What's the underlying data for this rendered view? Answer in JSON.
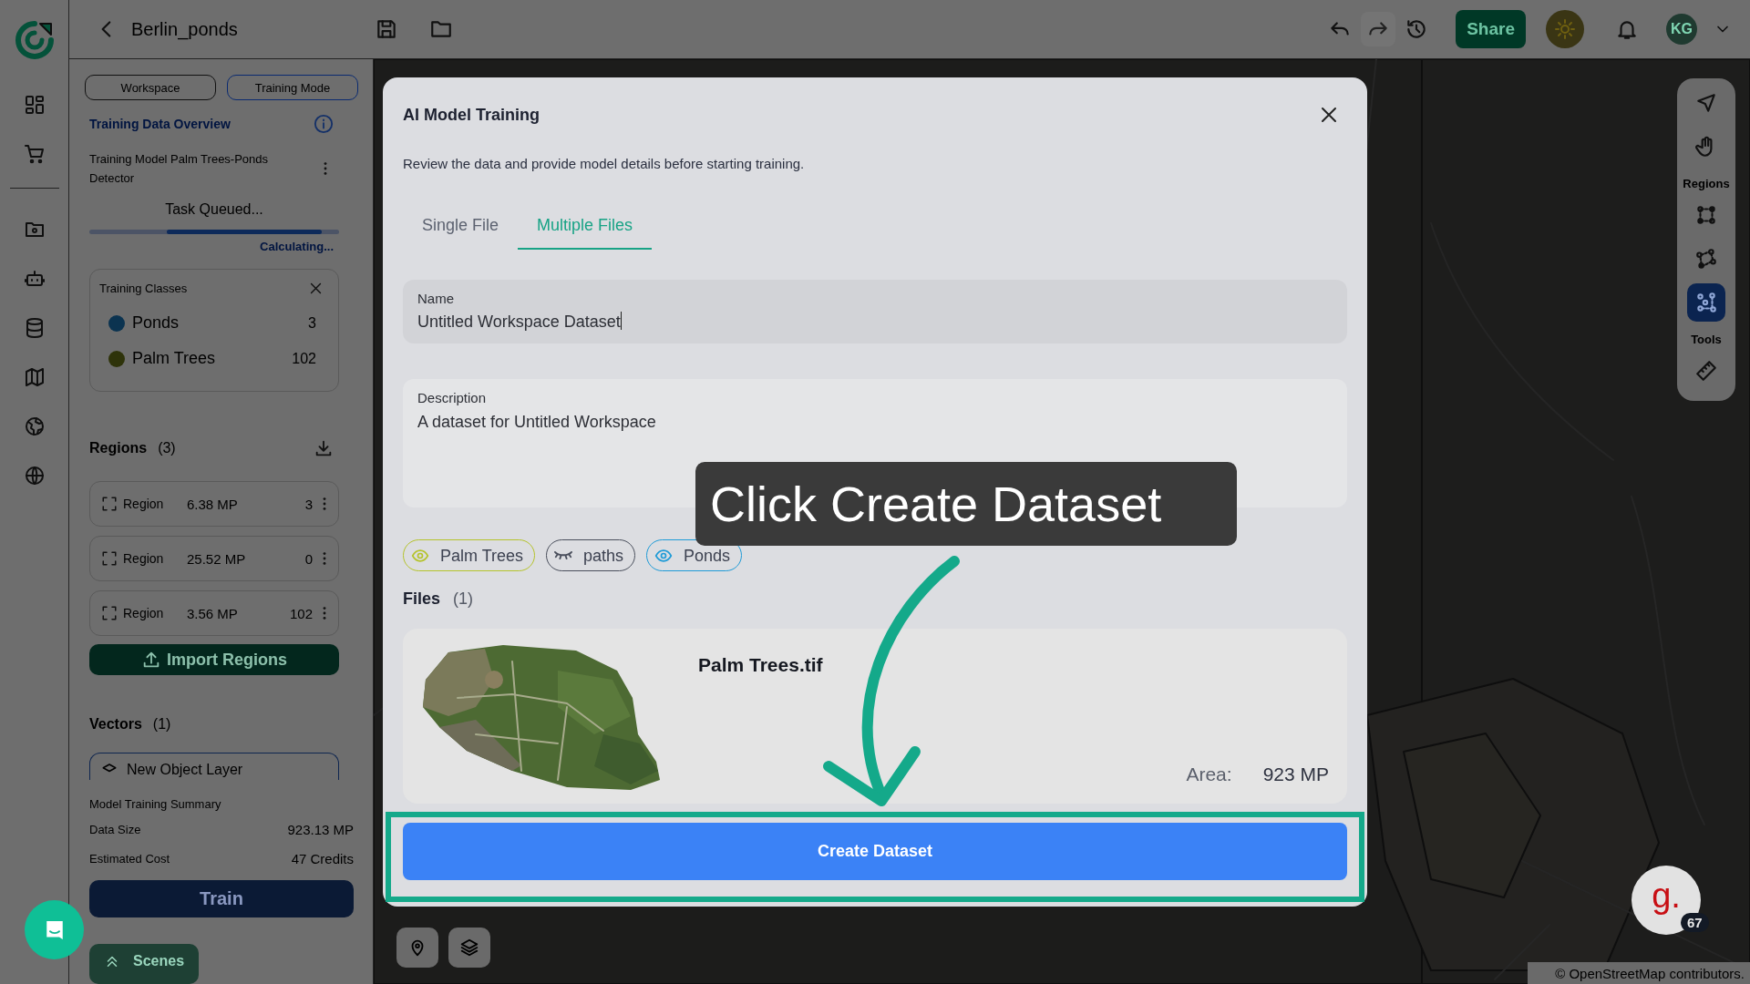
{
  "project": {
    "title": "Berlin_ponds"
  },
  "top_bar": {
    "share_button": "Share",
    "avatar": "KG"
  },
  "left_panel": {
    "mode_tabs": [
      {
        "label": "Workspace",
        "selected": false
      },
      {
        "label": "Training Mode",
        "selected": true
      }
    ],
    "overview_title": "Training Data Overview",
    "model_name": "Training Model Palm Trees-Ponds Detector",
    "task_status": "Task Queued...",
    "progress_note": "Calculating...",
    "classes": {
      "title": "Training Classes",
      "items": [
        {
          "name": "Ponds",
          "count": "3",
          "color": "#0b3350"
        },
        {
          "name": "Palm Trees",
          "count": "102",
          "color": "#2e330a"
        }
      ]
    },
    "regions": {
      "title": "Regions",
      "count": "(3)",
      "items": [
        {
          "label": "Region",
          "size": "6.38 MP",
          "count": "3"
        },
        {
          "label": "Region",
          "size": "25.52 MP",
          "count": "0"
        },
        {
          "label": "Region",
          "size": "3.56 MP",
          "count": "102"
        }
      ]
    },
    "import_button": "Import Regions",
    "vectors": {
      "title": "Vectors",
      "count": "(1)",
      "items": [
        {
          "name": "New Object Layer"
        }
      ]
    },
    "summary": {
      "title": "Model Training Summary",
      "rows": [
        {
          "label": "Data Size",
          "value": "923.13 MP"
        },
        {
          "label": "Estimated Cost",
          "value": "47 Credits"
        }
      ]
    },
    "train_button": "Train",
    "scenes_button": "Scenes"
  },
  "map": {
    "attribution": "© OpenStreetMap contributors.",
    "toolbar": {
      "tools": [
        {
          "kind": "pointer",
          "selected": false
        },
        {
          "kind": "hand",
          "selected": false
        }
      ],
      "regions_label": "Regions",
      "region_tools": [
        {
          "kind": "rectangle",
          "selected": false
        },
        {
          "kind": "polygon",
          "selected": false
        },
        {
          "kind": "points",
          "selected": true
        }
      ],
      "tools_label": "Tools",
      "measure_tools": [
        {
          "kind": "ruler",
          "selected": false
        }
      ]
    },
    "assistant": {
      "logo_text": "g.",
      "badge": "67"
    }
  },
  "modal": {
    "title": "AI Model Training",
    "subtitle": "Review the data and provide model details before starting training.",
    "tabs": [
      {
        "label": "Single File",
        "selected": false
      },
      {
        "label": "Multiple Files",
        "selected": true
      }
    ],
    "name_field": {
      "label": "Name",
      "value": "Untitled Workspace Dataset"
    },
    "description_field": {
      "label": "Description",
      "value": "A dataset for Untitled Workspace"
    },
    "class_chips": [
      {
        "label": "Palm Trees",
        "visible": true,
        "color": "#b5c32b"
      },
      {
        "label": "paths",
        "visible": false,
        "color": "#4a4f5c"
      },
      {
        "label": "Ponds",
        "visible": true,
        "color": "#1f9bd7"
      }
    ],
    "files_title": "Files",
    "files_count": "(1)",
    "files": [
      {
        "name": "Palm Trees.tif",
        "area_label": "Area:",
        "area": "923 MP"
      }
    ],
    "create_button": "Create Dataset"
  },
  "tooltip": {
    "text": "Click Create Dataset"
  }
}
